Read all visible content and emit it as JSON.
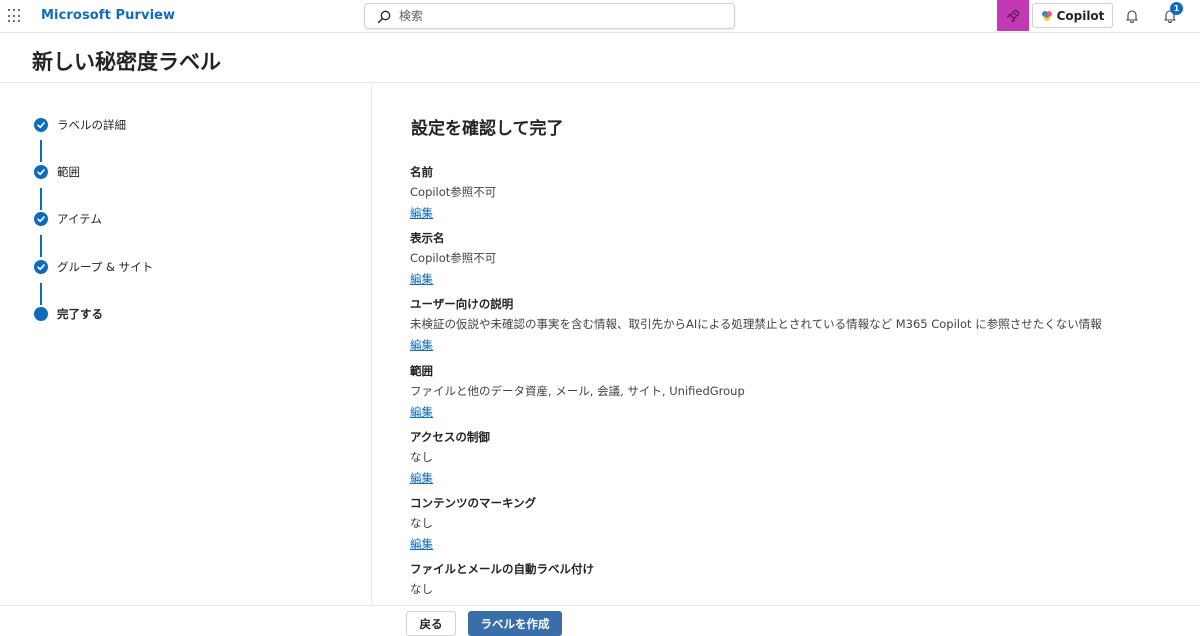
{
  "topbar": {
    "app_name": "Microsoft Purview",
    "search_placeholder": "検索",
    "copilot_label": "Copilot",
    "notification_count": "1"
  },
  "header": {
    "title": "新しい秘密度ラベル"
  },
  "steps": [
    {
      "label": "ラベルの詳細",
      "status": "completed"
    },
    {
      "label": "範囲",
      "status": "completed"
    },
    {
      "label": "アイテム",
      "status": "completed"
    },
    {
      "label": "グループ & サイト",
      "status": "completed"
    },
    {
      "label": "完了する",
      "status": "current"
    }
  ],
  "main": {
    "section_title": "設定を確認して完了",
    "edit_label": "編集",
    "fields": [
      {
        "label": "名前",
        "value": "Copilot参照不可"
      },
      {
        "label": "表示名",
        "value": "Copilot参照不可"
      },
      {
        "label": "ユーザー向けの説明",
        "value": "未検証の仮説や未確認の事実を含む情報、取引先からAIによる処理禁止とされている情報など M365 Copilot に参照させたくない情報"
      },
      {
        "label": "範囲",
        "value": "ファイルと他のデータ資産, メール, 会議, サイト, UnifiedGroup"
      },
      {
        "label": "アクセスの制御",
        "value": "なし"
      },
      {
        "label": "コンテンツのマーキング",
        "value": "なし"
      },
      {
        "label": "ファイルとメールの自動ラベル付け",
        "value": "なし"
      }
    ]
  },
  "footer": {
    "back_label": "戻る",
    "create_label": "ラベルを作成"
  },
  "colors": {
    "brand_blue": "#0f6cbd",
    "rocket_magenta": "#c239b3",
    "primary_button": "#3a6ea8"
  }
}
